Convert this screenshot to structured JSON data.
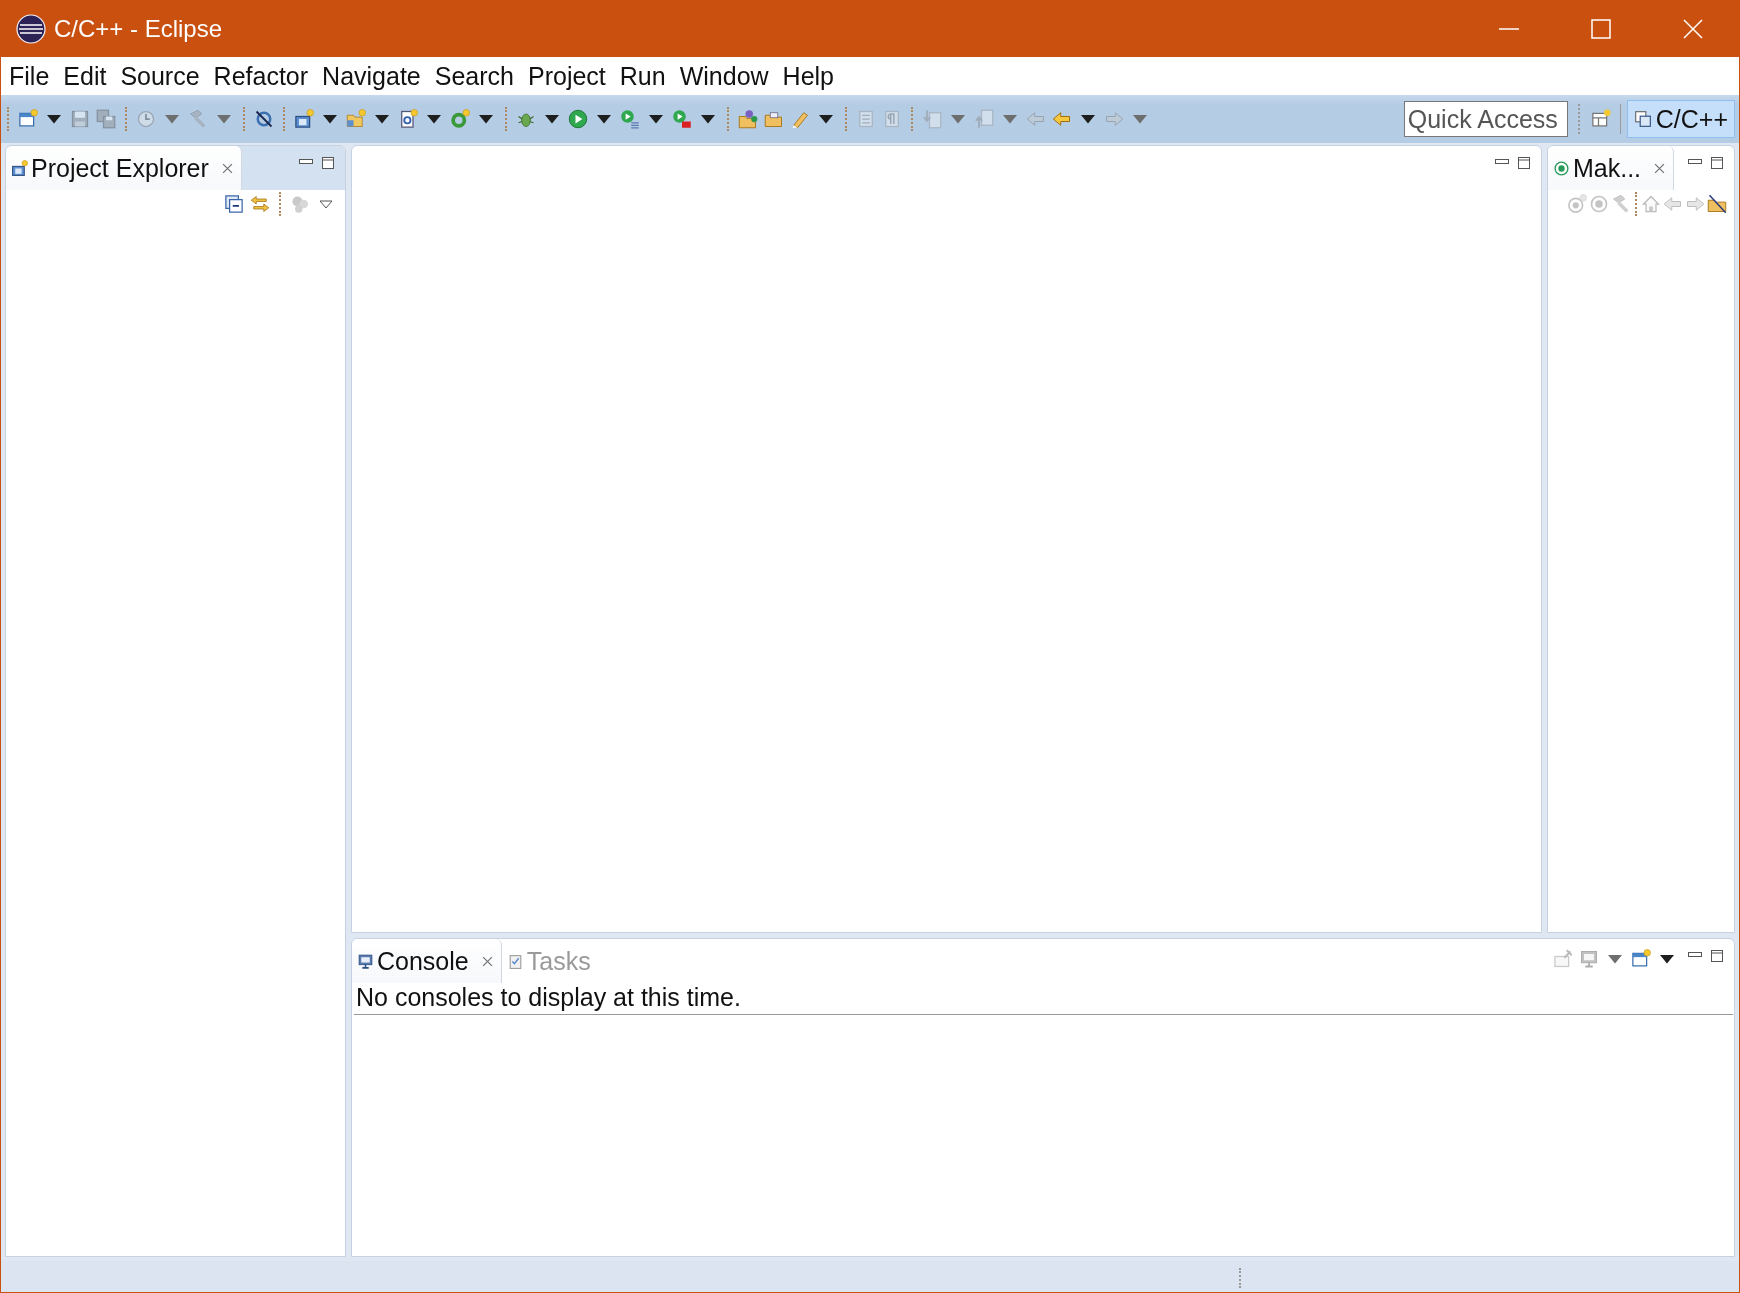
{
  "window": {
    "title": "C/C++ - Eclipse"
  },
  "menu": [
    "File",
    "Edit",
    "Source",
    "Refactor",
    "Navigate",
    "Search",
    "Project",
    "Run",
    "Window",
    "Help"
  ],
  "toolbar": [
    {
      "kind": "separator"
    },
    {
      "kind": "button",
      "disabled": false
    },
    {
      "kind": "dropdown",
      "disabled": false
    },
    {
      "kind": "button",
      "disabled": true
    },
    {
      "kind": "button",
      "disabled": true
    },
    {
      "kind": "separator"
    },
    {
      "kind": "button",
      "disabled": true
    },
    {
      "kind": "dropdown",
      "disabled": true
    },
    {
      "kind": "button",
      "disabled": true
    },
    {
      "kind": "dropdown",
      "disabled": true
    },
    {
      "kind": "separator"
    },
    {
      "kind": "button",
      "disabled": false
    },
    {
      "kind": "separator"
    },
    {
      "kind": "button",
      "disabled": false
    },
    {
      "kind": "dropdown",
      "disabled": false
    },
    {
      "kind": "button",
      "disabled": false
    },
    {
      "kind": "dropdown",
      "disabled": false
    },
    {
      "kind": "button",
      "disabled": false
    },
    {
      "kind": "dropdown",
      "disabled": false
    },
    {
      "kind": "button",
      "disabled": false
    },
    {
      "kind": "dropdown",
      "disabled": false
    },
    {
      "kind": "separator"
    },
    {
      "kind": "button",
      "disabled": false
    },
    {
      "kind": "dropdown",
      "disabled": false
    },
    {
      "kind": "button",
      "disabled": false
    },
    {
      "kind": "dropdown",
      "disabled": false
    },
    {
      "kind": "button",
      "disabled": false
    },
    {
      "kind": "dropdown",
      "disabled": false
    },
    {
      "kind": "button",
      "disabled": false
    },
    {
      "kind": "dropdown",
      "disabled": false
    },
    {
      "kind": "separator"
    },
    {
      "kind": "button",
      "disabled": false
    },
    {
      "kind": "button",
      "disabled": false
    },
    {
      "kind": "button",
      "disabled": false
    },
    {
      "kind": "dropdown",
      "disabled": false
    },
    {
      "kind": "separator"
    },
    {
      "kind": "button",
      "disabled": true
    },
    {
      "kind": "button",
      "disabled": true
    },
    {
      "kind": "separator"
    },
    {
      "kind": "button",
      "disabled": true
    },
    {
      "kind": "dropdown",
      "disabled": true
    },
    {
      "kind": "button",
      "disabled": true
    },
    {
      "kind": "dropdown",
      "disabled": true
    },
    {
      "kind": "button",
      "disabled": true
    },
    {
      "kind": "button",
      "disabled": false
    },
    {
      "kind": "dropdown",
      "disabled": false
    },
    {
      "kind": "button",
      "disabled": true
    },
    {
      "kind": "dropdown",
      "disabled": true
    }
  ],
  "quick_access": {
    "placeholder": "Quick Access"
  },
  "perspectives": [
    {
      "label": "C/C++",
      "selected": true
    }
  ],
  "project_explorer": {
    "tabs": [
      {
        "label": "Project Explorer",
        "selected": true,
        "closable": true
      }
    ],
    "tools": [
      {
        "kind": "button",
        "disabled": false
      },
      {
        "kind": "button",
        "disabled": false
      },
      {
        "kind": "separator"
      },
      {
        "kind": "button",
        "disabled": true
      },
      {
        "kind": "menu"
      }
    ]
  },
  "make_targets": {
    "tabs": [
      {
        "label": "Mak...",
        "selected": true,
        "closable": true
      }
    ],
    "tools": [
      {
        "kind": "button",
        "disabled": true
      },
      {
        "kind": "button",
        "disabled": true
      },
      {
        "kind": "button",
        "disabled": true
      },
      {
        "kind": "separator"
      },
      {
        "kind": "button",
        "disabled": true
      },
      {
        "kind": "button",
        "disabled": true
      },
      {
        "kind": "button",
        "disabled": true
      },
      {
        "kind": "button",
        "disabled": false
      }
    ]
  },
  "console": {
    "tabs": [
      {
        "label": "Console",
        "selected": true,
        "closable": true
      },
      {
        "label": "Tasks",
        "selected": false,
        "closable": false
      }
    ],
    "tools": [
      {
        "kind": "button",
        "disabled": true
      },
      {
        "kind": "button",
        "disabled": true
      },
      {
        "kind": "dropdown",
        "disabled": true
      },
      {
        "kind": "button",
        "disabled": false
      },
      {
        "kind": "dropdown",
        "disabled": false
      }
    ],
    "message": "No consoles to display at this time."
  }
}
